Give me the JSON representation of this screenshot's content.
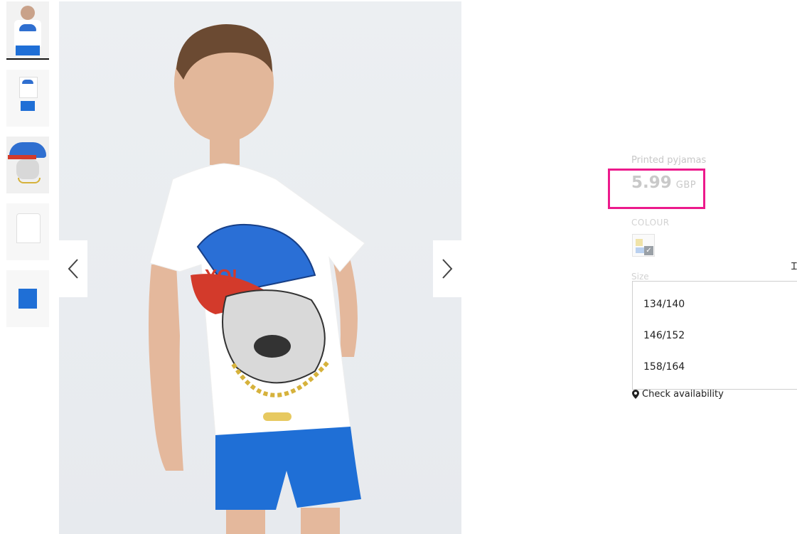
{
  "product": {
    "name": "Printed pyjamas",
    "price": "5.99",
    "currency": "GBP"
  },
  "colour": {
    "label": "COLOUR"
  },
  "size": {
    "label": "Size",
    "options": [
      "134/140",
      "146/152",
      "158/164"
    ]
  },
  "availability": {
    "label": "Check availability"
  },
  "icons": {
    "prev": "chevron-left-icon",
    "next": "chevron-right-icon",
    "pin": "map-pin-icon",
    "check": "check-icon"
  },
  "colors": {
    "highlight": "#ec1a8c",
    "tshirt": "#ffffff",
    "shorts": "#1f6fd6"
  }
}
